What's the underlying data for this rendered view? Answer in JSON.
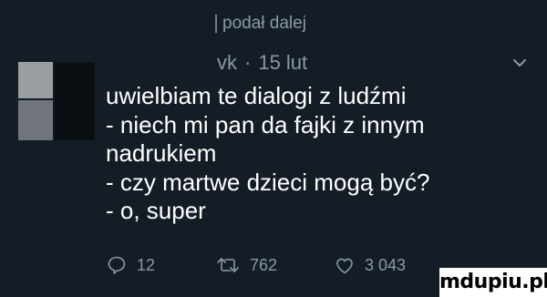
{
  "retweeted_by": "podał dalej",
  "author": {
    "handle": "vk",
    "separator": "·",
    "time": "15 lut"
  },
  "tweet": {
    "lines": [
      "uwielbiam te dialogi z ludźmi",
      "- niech mi pan da fajki z innym",
      "nadrukiem",
      "- czy martwe dzieci mogą być?",
      "- o, super"
    ]
  },
  "actions": {
    "replies": "12",
    "retweets": "762",
    "likes": "3 043"
  },
  "icons": {
    "caret": "chevron-down-icon",
    "reply": "reply-icon",
    "retweet": "retweet-icon",
    "like": "heart-icon"
  },
  "colors": {
    "background": "#141d26",
    "muted_text": "#8899a6",
    "text": "#ffffff"
  },
  "watermark": "mdupiu.pl"
}
